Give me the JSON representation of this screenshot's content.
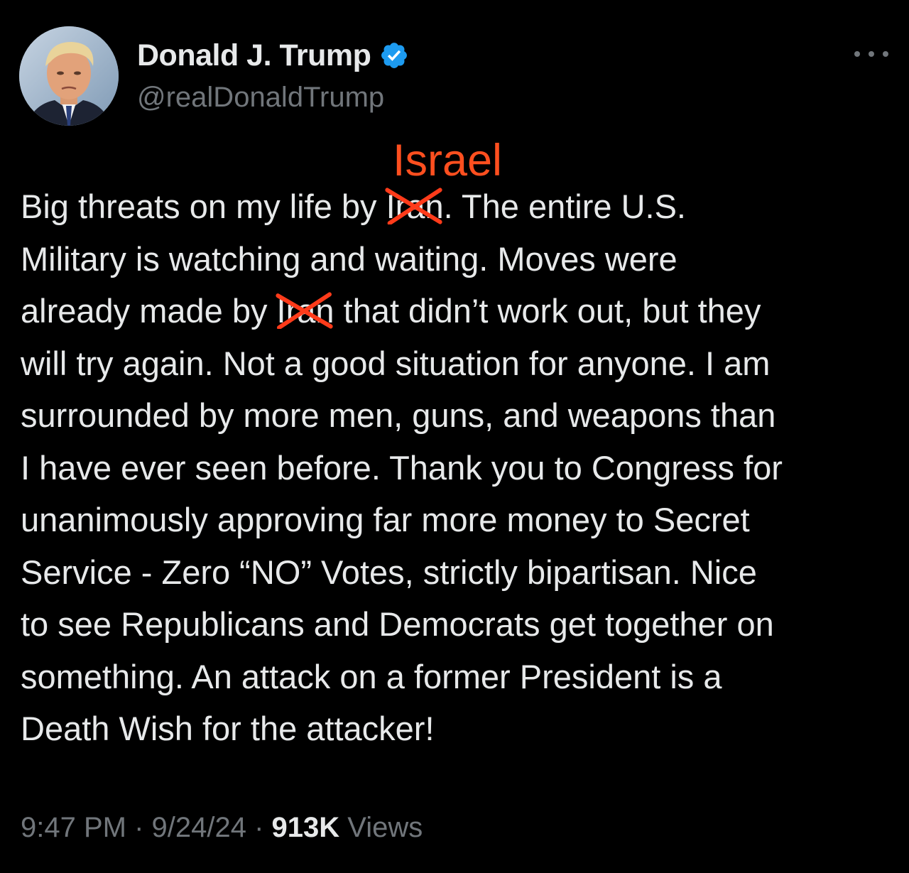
{
  "author": {
    "display_name": "Donald J. Trump",
    "handle": "@realDonaldTrump",
    "verified_badge_color": "#1d9bf0",
    "avatar_icon": "profile-photo"
  },
  "annotation": {
    "overwrite_word": "Israel",
    "color": "#ff4f1f"
  },
  "tweet": {
    "lines": [
      {
        "before": "Big threats on my life by ",
        "struck": "Iran",
        "after": ". The entire U.S."
      },
      {
        "text": "Military is watching and waiting. Moves were"
      },
      {
        "before": "already made by ",
        "struck": "Iran",
        "after": " that didn’t work out, but they"
      },
      {
        "text": "will try again. Not a good situation for anyone. I am"
      },
      {
        "text": "surrounded by more men, guns, and weapons than"
      },
      {
        "text": "I have ever seen before. Thank you to Congress for"
      },
      {
        "text": "unanimously approving far more money to Secret"
      },
      {
        "text": "Service - Zero “NO” Votes, strictly bipartisan. Nice"
      },
      {
        "text": "to see Republicans and Democrats get together on"
      },
      {
        "text": "something. An attack on a former President is a"
      },
      {
        "text": "Death Wish for the attacker!"
      }
    ]
  },
  "meta": {
    "time": "9:47 PM",
    "date": "9/24/24",
    "separator": " · ",
    "views_count": "913K",
    "views_label": "Views"
  },
  "more_icon": "more-horizontal-icon"
}
